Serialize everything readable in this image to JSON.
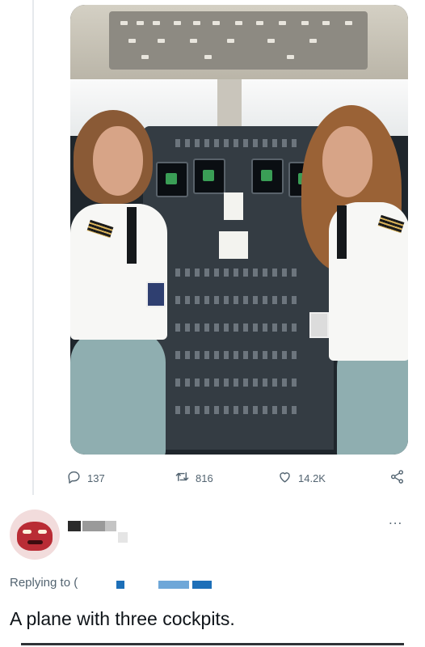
{
  "post": {
    "actions": {
      "reply_count": "137",
      "retweet_count": "816",
      "like_count": "14.2K"
    }
  },
  "reply": {
    "more_label": "...",
    "replying_prefix": "Replying to (",
    "text": "A plane with three cockpits."
  },
  "colors": {
    "icon_gray": "#536471",
    "redaction_blue": "#1d6fb8",
    "text": "#0f1419"
  },
  "icons": [
    "reply-icon",
    "retweet-icon",
    "like-icon",
    "share-icon",
    "more-icon"
  ]
}
